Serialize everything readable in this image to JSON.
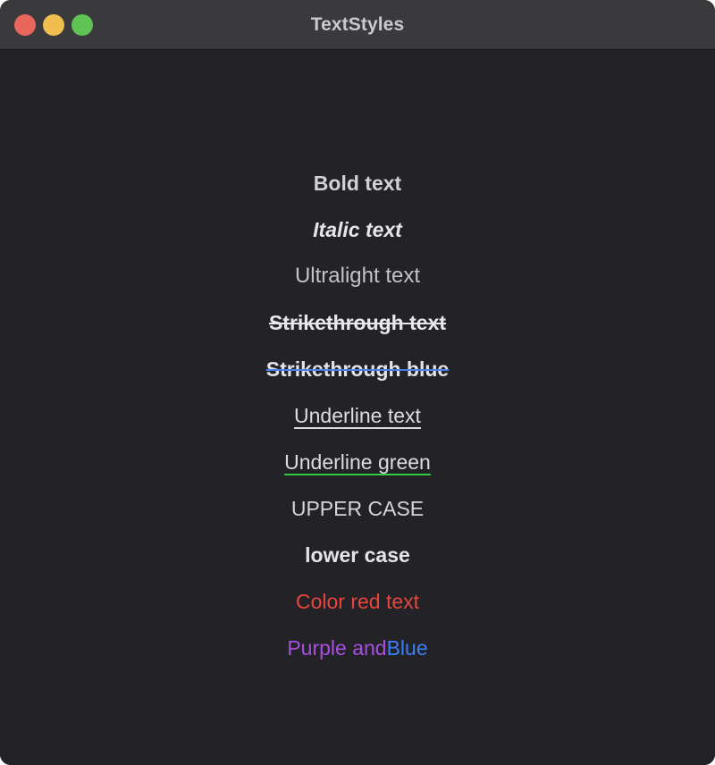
{
  "window": {
    "title": "TextStyles",
    "controls": [
      {
        "name": "close-button",
        "color": "#e8665c"
      },
      {
        "name": "minimize-button",
        "color": "#f0bd4f"
      },
      {
        "name": "zoom-button",
        "color": "#5fc454"
      }
    ],
    "background_color": "#222227",
    "titlebar_color": "#3a3a3c"
  },
  "rows": [
    {
      "label": "Bold text",
      "style": "bold"
    },
    {
      "label": "Italic text",
      "style": "italic"
    },
    {
      "label": "Ultralight text",
      "style": "ultralight"
    },
    {
      "label": "Strikethrough text",
      "style": "strikethrough"
    },
    {
      "label": "Strikethrough blue",
      "style": "strikethrough-blue",
      "decoration_color": "#4a7fe8"
    },
    {
      "label": "Underline text",
      "style": "underline"
    },
    {
      "label": "Underline green",
      "style": "underline-green",
      "decoration_color": "#33cc4a"
    },
    {
      "label": "UPPER CASE",
      "style": "uppercase"
    },
    {
      "label": "lower case",
      "style": "lowercase"
    },
    {
      "label": "Color red text",
      "style": "color",
      "color": "#e8453c"
    },
    {
      "style": "multicolor",
      "parts": [
        {
          "label": "Purple and ",
          "color": "#a94fe0"
        },
        {
          "label": "Blue",
          "color": "#3b7ff5"
        }
      ]
    }
  ]
}
